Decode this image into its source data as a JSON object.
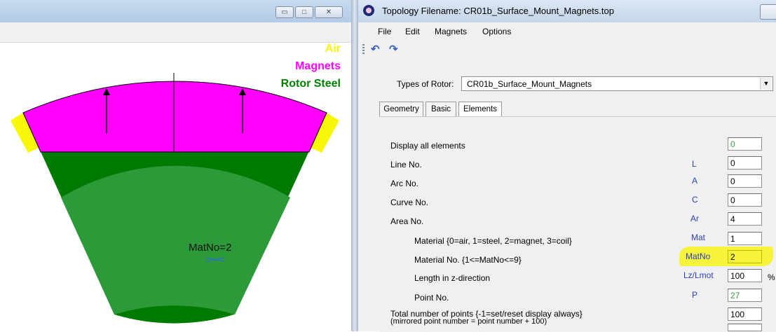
{
  "left_window": {
    "legend": {
      "air": {
        "label": "Air",
        "color": "#f8f70a"
      },
      "magnets": {
        "label": "Magnets",
        "color": "#ff00ff"
      },
      "rotor_steel": {
        "label": "Rotor Steel",
        "color": "#008000"
      }
    },
    "area_label": "MatNo=2",
    "colors": {
      "steel": "#007a00",
      "selected_area": "#2d9a3a",
      "magnet": "#ff00ff",
      "air": "#f8f70a"
    }
  },
  "right_window": {
    "title": "Topology Filename: CR01b_Surface_Mount_Magnets.top",
    "menu": [
      "File",
      "Edit",
      "Magnets",
      "Options"
    ],
    "toolbar": {
      "undo_icon": "undo-icon",
      "redo_icon": "redo-icon"
    },
    "rotor_type": {
      "label": "Types of Rotor:",
      "value": "CR01b_Surface_Mount_Magnets"
    },
    "tabs": [
      {
        "label": "Geometry",
        "active": false
      },
      {
        "label": "Basic",
        "active": false
      },
      {
        "label": "Elements",
        "active": true
      }
    ],
    "rows": [
      {
        "label": "Display all elements",
        "code": "",
        "value": "0",
        "dim": true
      },
      {
        "label": "Line No.",
        "code": "L",
        "value": "0",
        "dim": false
      },
      {
        "label": "Arc No.",
        "code": "A",
        "value": "0",
        "dim": false
      },
      {
        "label": "Curve No.",
        "code": "C",
        "value": "0",
        "dim": false
      },
      {
        "label": "Area No.",
        "code": "Ar",
        "value": "4",
        "dim": false
      },
      {
        "label": "Material {0=air, 1=steel, 2=magnet, 3=coil}",
        "code": "Mat",
        "value": "1",
        "dim": false
      },
      {
        "label": "Material No. {1<=MatNo<=9}",
        "code": "MatNo",
        "value": "2",
        "dim": false
      },
      {
        "label": "Length in z-direction",
        "code": "Lz/Lmot",
        "value": "100",
        "dim": false,
        "unit": "%"
      },
      {
        "label": "Point No.",
        "code": "P",
        "value": "27",
        "dim": true
      },
      {
        "label": "Total number of points {-1=set/reset display always}",
        "code": "",
        "value": "100",
        "dim": false
      }
    ],
    "points_note": "(mirrored point number = point number + 100)",
    "highlight_color": "#f6f33d"
  }
}
